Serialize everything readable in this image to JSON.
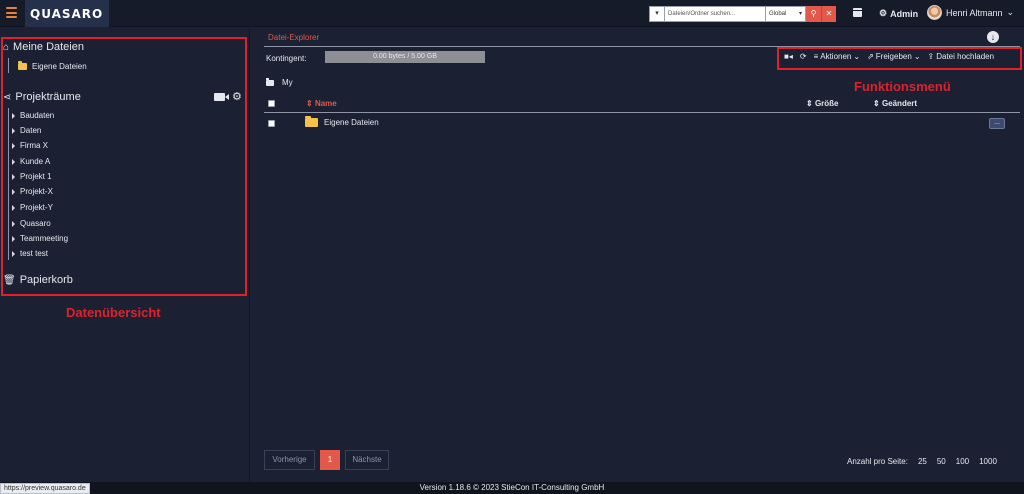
{
  "topbar": {
    "logo": "QUASARO",
    "search_placeholder": "Dateien/Ordner suchen...",
    "search_scope": "Global",
    "admin_label": "Admin",
    "user_name": "Henri Altmann"
  },
  "sidebar": {
    "my_files_title": "Meine Dateien",
    "my_files_item": "Eigene Dateien",
    "rooms_title": "Projekträume",
    "rooms": [
      "Baudaten",
      "Daten",
      "Firma X",
      "Kunde A",
      "Projekt 1",
      "Projekt-X",
      "Projekt-Y",
      "Quasaro",
      "Teammeeting",
      "test test"
    ],
    "trash_title": "Papierkorb",
    "annotation": "Datenübersicht"
  },
  "main": {
    "tab_label": "Datei-Explorer",
    "quota_label": "Kontingent:",
    "quota_value": "0.00 bytes / 5.00 GB",
    "quota_fraction": 0,
    "toolbar": {
      "actions": "Aktionen",
      "share": "Freigeben",
      "upload": "Datei hochladen"
    },
    "annotation": "Funktionsmenü",
    "breadcrumb": "My",
    "columns": {
      "name": "Name",
      "size": "Größe",
      "modified": "Geändert"
    },
    "rows": [
      {
        "name": "Eigene Dateien",
        "menu": "..."
      }
    ]
  },
  "pagination": {
    "prev": "Vorherige",
    "current": "1",
    "next": "Nächste",
    "per_page_label": "Anzahl pro Seite:",
    "per_page_options": [
      "25",
      "50",
      "100",
      "1000"
    ]
  },
  "footer": {
    "version": "Version 1.18.6 © 2023 StieCon IT-Consulting GmbH",
    "status_url": "https://preview.quasaro.de"
  },
  "colors": {
    "accent": "#e2584a",
    "annotation_red": "#e0202a",
    "background": "#1b2133",
    "folder": "#f4c14d"
  }
}
